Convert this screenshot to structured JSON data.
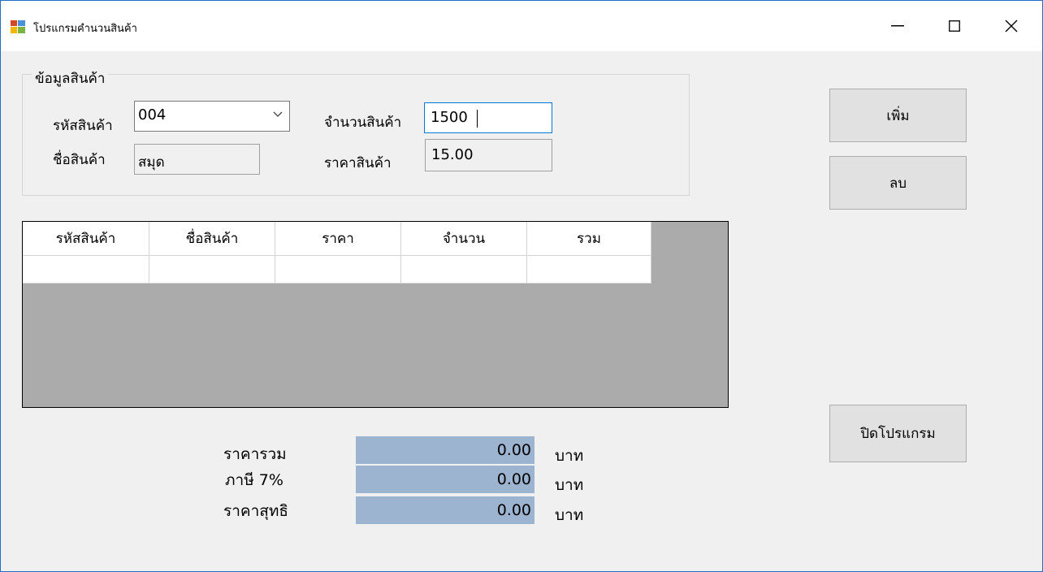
{
  "window": {
    "title": "โปรแกรมคำนวนสินค้า",
    "controls": {
      "minimize": "—",
      "maximize": "☐",
      "close": "✕"
    }
  },
  "product_info": {
    "group_title": "ข้อมูลสินค้า",
    "code_label": "รหัสสินค้า",
    "code_value": "004",
    "name_label": "ชื่อสินค้า",
    "name_value": "สมุด",
    "quantity_label": "จำนวนสินค้า",
    "quantity_value": "1500",
    "price_label": "ราคาสินค้า",
    "price_value": "15.00"
  },
  "buttons": {
    "add": "เพิ่ม",
    "delete": "ลบ",
    "close": "ปิดโปรแกรม"
  },
  "grid": {
    "columns": [
      "รหัสสินค้า",
      "ชื่อสินค้า",
      "ราคา",
      "จำนวน",
      "รวม"
    ],
    "rows": [
      [
        "",
        "",
        "",
        "",
        ""
      ]
    ]
  },
  "totals": {
    "subtotal_label": "ราคารวม",
    "subtotal_value": "0.00",
    "tax_label": "ภาษี 7%",
    "tax_value": "0.00",
    "net_label": "ราคาสุทธิ",
    "net_value": "0.00",
    "unit": "บาท"
  },
  "colors": {
    "title_bar": "#ffffff",
    "form_bg": "#f0f0f0",
    "grid_bg": "#ababab",
    "total_box": "#9db4d0",
    "focus_border": "#0078d7"
  }
}
